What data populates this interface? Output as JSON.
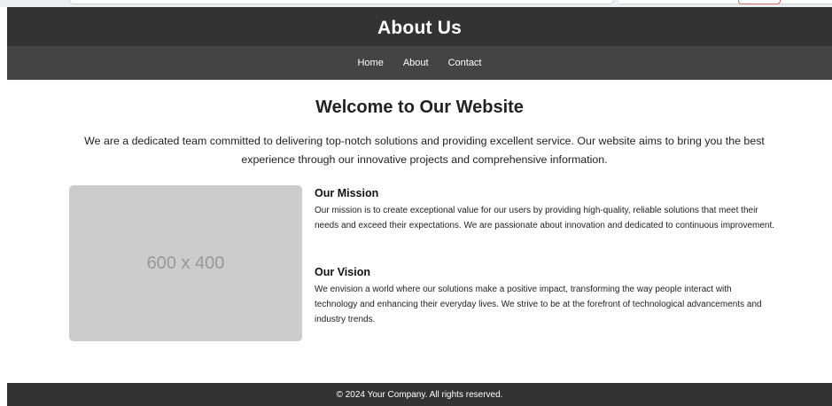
{
  "header": {
    "title": "About Us",
    "nav": [
      "Home",
      "About",
      "Contact"
    ]
  },
  "main": {
    "heading": "Welcome to Our Website",
    "intro": "We are a dedicated team committed to delivering top-notch solutions and providing excellent service. Our website aims to bring you the best experience through our innovative projects and comprehensive information.",
    "image_label": "600 x 400",
    "mission": {
      "title": "Our Mission",
      "text": "Our mission is to create exceptional value for our users by providing high-quality, reliable solutions that meet their needs and exceed their expectations. We are passionate about innovation and dedicated to continuous improvement."
    },
    "vision": {
      "title": "Our Vision",
      "text": "We envision a world where our solutions make a positive impact, transforming the way people interact with technology and enhancing their everyday lives. We strive to be at the forefront of technological advancements and industry trends."
    }
  },
  "footer": {
    "copyright": "© 2024 Your Company. All rights reserved."
  },
  "colors": {
    "header_bg": "#333333",
    "nav_bg": "#444444",
    "placeholder_bg": "#cccccc"
  }
}
